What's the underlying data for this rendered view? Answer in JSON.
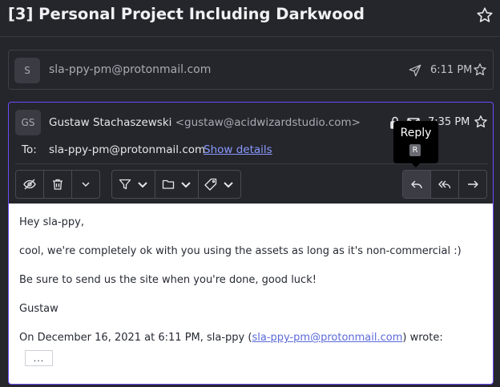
{
  "thread": {
    "title": "[3] Personal Project Including Darkwood"
  },
  "collapsed_message": {
    "avatar_initial": "S",
    "sender": "sla-ppy-pm@protonmail.com",
    "time": "6:11 PM"
  },
  "expanded_message": {
    "avatar_initials": "GS",
    "from_name": "Gustaw Stachaszewski",
    "from_address": "<gustaw@acidwizardstudio.com>",
    "time": "7:35 PM",
    "to_label": "To:",
    "to_address": "sla-ppy-pm@protonmail.com",
    "show_details": "Show details"
  },
  "tooltip": {
    "label": "Reply",
    "shortcut": "R"
  },
  "body": {
    "greeting": "Hey sla-ppy,",
    "line1": "cool, we're completely ok with you using the assets as long as it's non-commercial :)",
    "line2": "Be sure to send us the site when you're done, good luck!",
    "signature": "Gustaw",
    "quote_prefix": "On December 16, 2021 at 6:11 PM, sla-ppy (",
    "quote_email": "sla-ppy-pm@protonmail.com",
    "quote_suffix": ") wrote:",
    "expand_quote": "..."
  },
  "colors": {
    "background": "#25262b",
    "accent_border": "#6d4aff",
    "link": "#8a98ff",
    "body_background": "#ffffff"
  }
}
